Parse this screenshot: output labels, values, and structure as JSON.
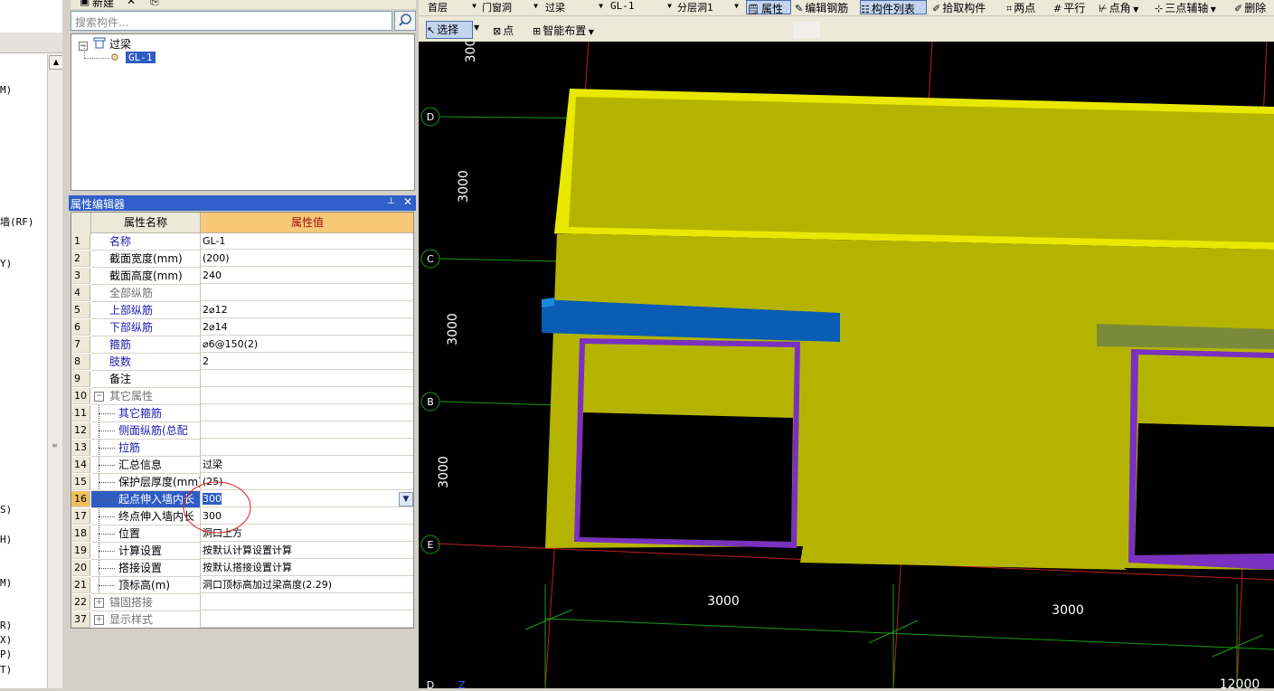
{
  "left_fragments": [
    "M)",
    "墙(RF)",
    "Y)",
    "S)",
    "H)",
    "M)",
    "R)",
    "X)",
    "P)",
    "T)"
  ],
  "component_panel": {
    "toolbar": {
      "new_label": "新建",
      "delete_glyph": "✕"
    },
    "search_placeholder": "搜索构件...",
    "tree": {
      "root_label": "过梁",
      "child_label": "GL-1"
    }
  },
  "property_editor": {
    "title": "属性编辑器",
    "col_name": "属性名称",
    "col_value": "属性值",
    "rows": [
      {
        "n": "1",
        "name": "名称",
        "value": "GL-1"
      },
      {
        "n": "2",
        "name": "截面宽度(mm)",
        "value": "(200)"
      },
      {
        "n": "3",
        "name": "截面高度(mm)",
        "value": "240"
      },
      {
        "n": "4",
        "name": "全部纵筋",
        "value": ""
      },
      {
        "n": "5",
        "name": "上部纵筋",
        "value": "2⌀12"
      },
      {
        "n": "6",
        "name": "下部纵筋",
        "value": "2⌀14"
      },
      {
        "n": "7",
        "name": "箍筋",
        "value": "⌀6@150(2)"
      },
      {
        "n": "8",
        "name": "肢数",
        "value": "2"
      },
      {
        "n": "9",
        "name": "备注",
        "value": ""
      },
      {
        "n": "10",
        "name": "其它属性",
        "value": ""
      },
      {
        "n": "11",
        "name": "其它箍筋",
        "value": ""
      },
      {
        "n": "12",
        "name": "侧面纵筋(总配",
        "value": ""
      },
      {
        "n": "13",
        "name": "拉筋",
        "value": ""
      },
      {
        "n": "14",
        "name": "汇总信息",
        "value": "过梁"
      },
      {
        "n": "15",
        "name": "保护层厚度(mm)",
        "value": "(25)"
      },
      {
        "n": "16",
        "name": "起点伸入墙内长",
        "value": "300"
      },
      {
        "n": "17",
        "name": "终点伸入墙内长",
        "value": "300"
      },
      {
        "n": "18",
        "name": "位置",
        "value": "洞口上方"
      },
      {
        "n": "19",
        "name": "计算设置",
        "value": "按默认计算设置计算"
      },
      {
        "n": "20",
        "name": "搭接设置",
        "value": "按默认搭接设置计算"
      },
      {
        "n": "21",
        "name": "顶标高(m)",
        "value": "洞口顶标高加过梁高度(2.29)"
      },
      {
        "n": "22",
        "name": "锚固搭接",
        "value": ""
      },
      {
        "n": "37",
        "name": "显示样式",
        "value": ""
      }
    ]
  },
  "toolbar1": {
    "floor": "首层",
    "type": "门窗洞",
    "subtype": "过梁",
    "component": "GL-1",
    "layer": "分层洞1",
    "btn_props": "属性",
    "btn_edit_rebar": "编辑钢筋",
    "btn_list": "构件列表",
    "btn_pick": "拾取构件",
    "btn_two_points": "两点",
    "btn_parallel": "平行",
    "btn_angle": "点角",
    "btn_three_axis": "三点辅轴",
    "btn_delete": "删除"
  },
  "toolbar2": {
    "select": "选择",
    "point": "点",
    "smart": "智能布置"
  },
  "canvas": {
    "axis_labels": [
      "D",
      "C",
      "B",
      "E",
      "D"
    ],
    "dims_vertical": [
      "3000",
      "3000",
      "3000",
      "300"
    ],
    "dims_horizontal": [
      "3000",
      "3000",
      "12000"
    ],
    "colors": {
      "wall": "#b4b400",
      "wall_top": "#e8e800",
      "beam_blue": "#0a5cb4",
      "beam_olive": "#7a8a3a",
      "frame": "#7a30c0",
      "grid_red": "#c02020",
      "grid_green": "#1a9a1a"
    }
  }
}
